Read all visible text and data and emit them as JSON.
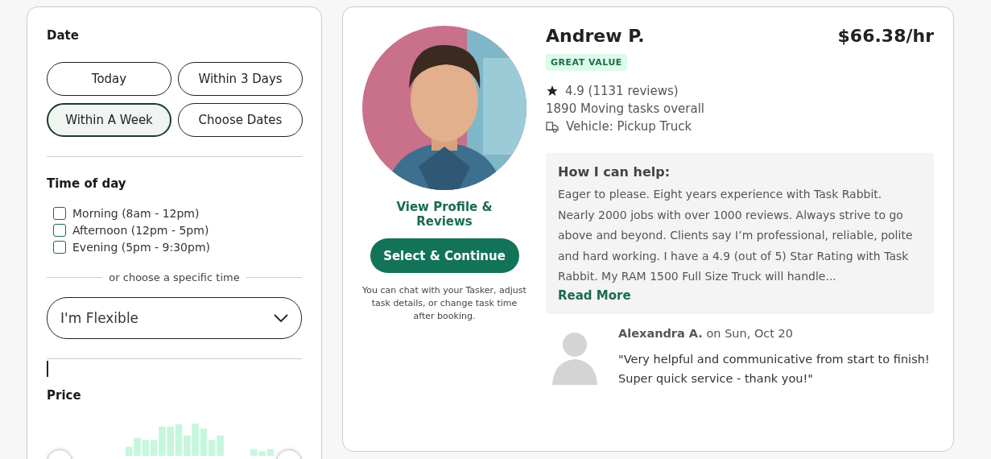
{
  "filters": {
    "date": {
      "heading": "Date",
      "options": [
        {
          "label": "Today",
          "selected": false
        },
        {
          "label": "Within 3 Days",
          "selected": false
        },
        {
          "label": "Within A Week",
          "selected": true
        },
        {
          "label": "Choose Dates",
          "selected": false
        }
      ]
    },
    "time_of_day": {
      "heading": "Time of day",
      "options": [
        {
          "label": "Morning (8am - 12pm)",
          "checked": false
        },
        {
          "label": "Afternoon (12pm - 5pm)",
          "checked": false
        },
        {
          "label": "Evening (5pm - 9:30pm)",
          "checked": false
        }
      ],
      "separator": "or choose a specific time",
      "dropdown": {
        "value": "I'm Flexible"
      }
    },
    "price": {
      "heading": "Price"
    }
  },
  "tasker": {
    "name": "Andrew P.",
    "rate": "$66.38/hr",
    "badge": "GREAT VALUE",
    "rating": "4.9 (1131 reviews)",
    "tasks": "1890 Moving tasks overall",
    "vehicle": "Vehicle: Pickup Truck",
    "profile_link": "View Profile & Reviews",
    "select_button": "Select & Continue",
    "note": "You can chat with your Tasker, adjust task details, or change task time after booking.",
    "help": {
      "heading": "How I can help:",
      "text": "Eager to please. Eight years experience with Task Rabbit. Nearly 2000 jobs with over 1000 reviews. Always strive to go above and beyond. Clients say I’m professional, reliable, polite and hard working. I have a 4.9 (out of 5) Star Rating with Task Rabbit. My RAM 1500 Full Size Truck will handle...",
      "read_more": "Read More"
    },
    "review": {
      "author": "Alexandra A.",
      "date": "on Sun, Oct 20",
      "text": "\"Very helpful and communicative from start to finish! Super quick service - thank you!\""
    }
  }
}
